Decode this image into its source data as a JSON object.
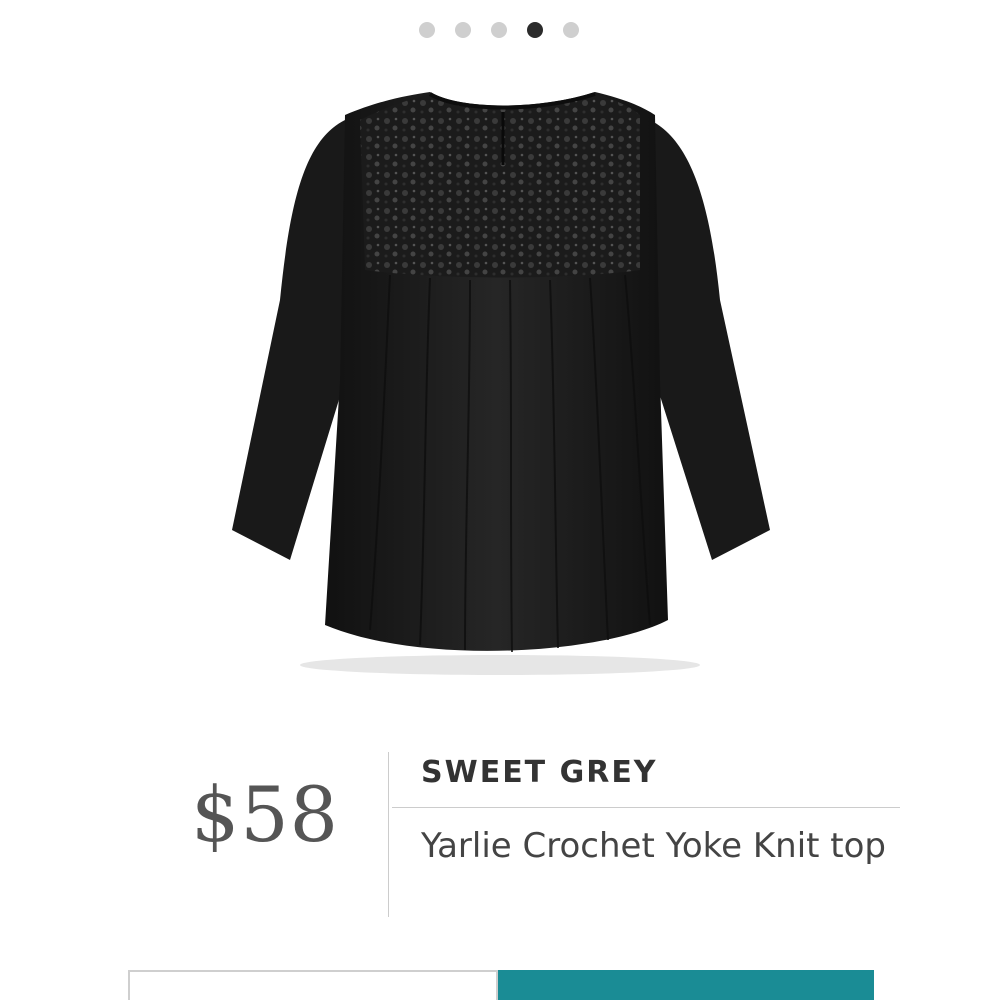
{
  "carousel": {
    "total": 5,
    "active_index": 3
  },
  "product": {
    "price": "$58",
    "brand": "SWEET GREY",
    "name": "Yarlie Crochet Yoke Knit top",
    "image_icon": "black-crochet-yoke-top-image"
  },
  "colors": {
    "accent": "#1a8c95",
    "dot_active": "#2b2b2b",
    "dot_inactive": "#cfcfcf",
    "garment": "#1b1b1b"
  }
}
